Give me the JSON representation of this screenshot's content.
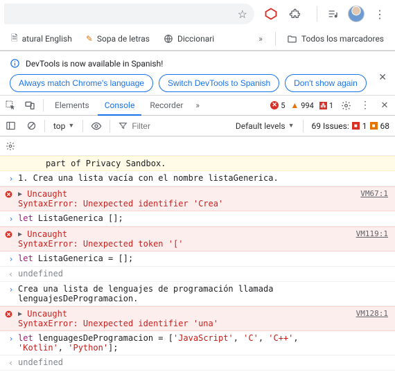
{
  "addrbar": {
    "star_icon": "star-icon",
    "extensions_icon": "puzzle-icon",
    "music_icon": "music-icon"
  },
  "bookmarks": {
    "items": [
      {
        "icon": "doc-icon",
        "label": "atural English",
        "truncated_prefix": true
      },
      {
        "icon": "pencil-icon",
        "label": "Sopa de letras"
      },
      {
        "icon": "globe-icon",
        "label": "Diccionari"
      }
    ],
    "overflow_label": "»",
    "all_bookmarks_label": "Todos los marcadores"
  },
  "notice": {
    "message": "DevTools is now available in Spanish!",
    "buttons": [
      "Always match Chrome's language",
      "Switch DevTools to Spanish",
      "Don't show again"
    ]
  },
  "tabs": {
    "items": [
      "Elements",
      "Console",
      "Recorder"
    ],
    "active_index": 1,
    "overflow": "»",
    "error_count": "5",
    "warn_count": "994",
    "ext_count": "1"
  },
  "toolbar": {
    "context": "top",
    "filter_placeholder": "Filter",
    "levels": "Default levels",
    "issues_label": "69 Issues:",
    "issues_red": "1",
    "issues_orange": "68"
  },
  "console_rows": [
    {
      "type": "warn",
      "gutter": "",
      "text": "part of Privacy Sandbox.",
      "indent": true
    },
    {
      "type": "input",
      "gutter": ">",
      "text": "1. Crea una lista vacía con el nombre listaGenerica."
    },
    {
      "type": "err",
      "gutter": "x",
      "text": "Uncaught\nSyntaxError: Unexpected identifier 'Crea'",
      "src": "VM67:1"
    },
    {
      "type": "input",
      "gutter": ">",
      "html": "<span class='kw'>let</span> ListaGenerica [];"
    },
    {
      "type": "err",
      "gutter": "x",
      "text": "Uncaught\nSyntaxError: Unexpected token '['",
      "src": "VM119:1"
    },
    {
      "type": "input",
      "gutter": ">",
      "html": "<span class='kw'>let</span> ListaGenerica = [];"
    },
    {
      "type": "output",
      "gutter": "<",
      "html": "<span class='undef'>undefined</span>"
    },
    {
      "type": "input",
      "gutter": ">",
      "text": "Crea una lista de lenguajes de programación llamada lenguajesDeProgramacion."
    },
    {
      "type": "err",
      "gutter": "x",
      "text": "Uncaught\nSyntaxError: Unexpected identifier 'una'",
      "src": "VM128:1"
    },
    {
      "type": "input",
      "gutter": ">",
      "html": "<span class='kw'>let</span> lenguagesDeProgramacion = [<span class='str'>'JavaScript'</span>, <span class='str'>'C'</span>, <span class='str'>'C++'</span>, <span class='str'>'Kotlin'</span>, <span class='str'>'Python'</span>];"
    },
    {
      "type": "output",
      "gutter": "<",
      "html": "<span class='undef'>undefined</span>"
    }
  ]
}
